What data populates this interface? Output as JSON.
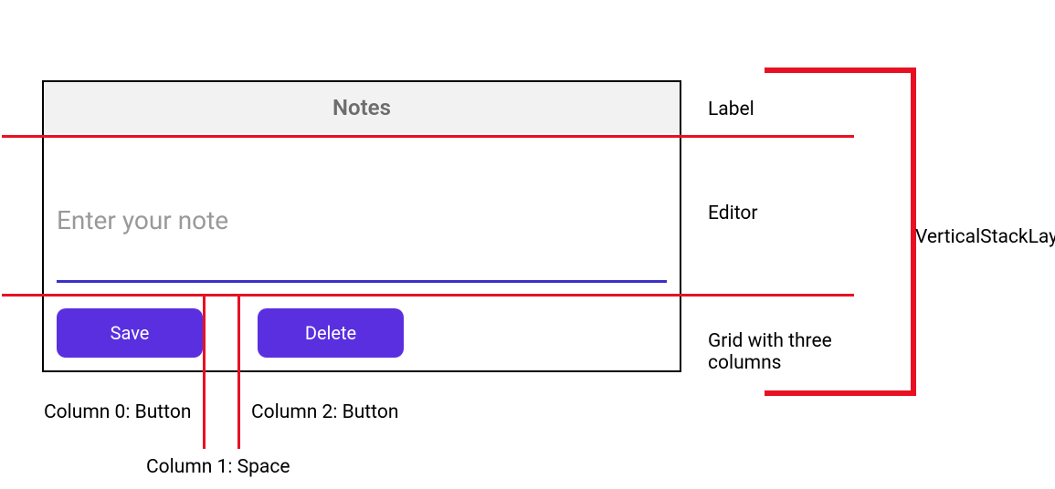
{
  "app": {
    "title": "Notes",
    "editor_placeholder": "Enter your note",
    "buttons": {
      "save": "Save",
      "delete": "Delete"
    }
  },
  "annotations": {
    "label": "Label",
    "editor": "Editor",
    "grid": "Grid with three columns",
    "vertical_stack": "VerticalStackLayout",
    "col0": "Column 0: Button",
    "col1": "Column 1: Space",
    "col2": "Column 2: Button"
  },
  "colors": {
    "annotation_line": "#e81123",
    "button_bg": "#5a2fe0",
    "editor_underline": "#3b2fc7"
  }
}
